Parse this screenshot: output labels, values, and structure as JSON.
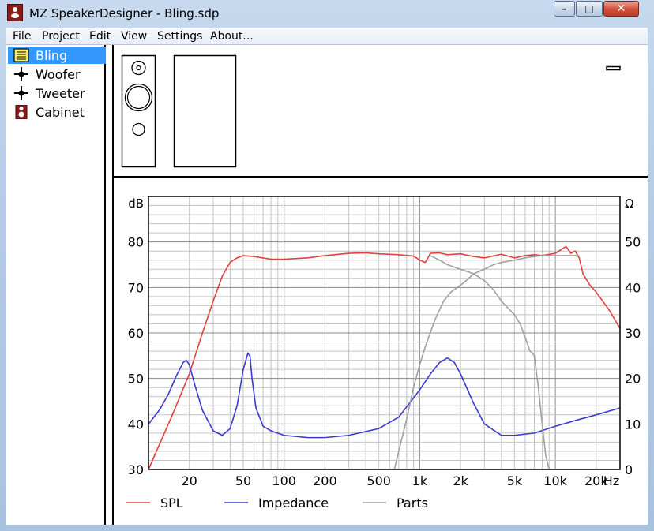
{
  "window": {
    "title": "MZ SpeakerDesigner - Bling.sdp",
    "minimize_glyph": "–",
    "maximize_glyph": "□",
    "close_glyph": "✕"
  },
  "menu": [
    "File",
    "Project",
    "Edit",
    "View",
    "Settings",
    "About..."
  ],
  "tree": [
    {
      "label": "Bling",
      "icon": "document-icon",
      "selected": true
    },
    {
      "label": "Woofer",
      "icon": "driver-node-icon",
      "selected": false
    },
    {
      "label": "Tweeter",
      "icon": "driver-node-icon",
      "selected": false
    },
    {
      "label": "Cabinet",
      "icon": "cabinet-icon",
      "selected": false
    }
  ],
  "chart_data": {
    "type": "line",
    "left_axis_unit": "dB",
    "right_axis_unit": "Ω",
    "x_unit": "Hz",
    "x_scale": "log",
    "xlim": [
      10,
      30000
    ],
    "ylim_left": [
      30,
      90
    ],
    "ylim_right": [
      0,
      60
    ],
    "grid": true,
    "legend_position": "bottom",
    "x_tick_labels": [
      "20",
      "50",
      "100",
      "200",
      "500",
      "1k",
      "2k",
      "5k",
      "10k",
      "20k"
    ],
    "x_tick_values": [
      20,
      50,
      100,
      200,
      500,
      1000,
      2000,
      5000,
      10000,
      20000
    ],
    "y_left_tick_labels": [
      "30",
      "40",
      "50",
      "60",
      "70",
      "80"
    ],
    "y_left_tick_values": [
      30,
      40,
      50,
      60,
      70,
      80
    ],
    "y_right_tick_labels": [
      "0",
      "10",
      "20",
      "30",
      "40",
      "50"
    ],
    "y_right_tick_values": [
      0,
      10,
      20,
      30,
      40,
      50
    ],
    "series": [
      {
        "name": "SPL",
        "color": "#e04040",
        "axis": "left",
        "x": [
          10,
          15,
          20,
          25,
          30,
          35,
          40,
          45,
          50,
          60,
          80,
          100,
          150,
          200,
          300,
          400,
          500,
          700,
          900,
          1000,
          1100,
          1200,
          1400,
          1600,
          2000,
          2500,
          3000,
          4000,
          5000,
          6000,
          7000,
          8000,
          10000,
          12000,
          13000,
          14000,
          15000,
          16000,
          18000,
          20000,
          25000,
          30000
        ],
        "y": [
          30,
          42,
          51,
          60,
          67,
          72.5,
          75.5,
          76.5,
          77,
          76.8,
          76.2,
          76.2,
          76.5,
          77,
          77.5,
          77.6,
          77.4,
          77.2,
          76.9,
          76,
          75.5,
          77.5,
          77.6,
          77.2,
          77.4,
          76.8,
          76.5,
          77.3,
          76.5,
          77,
          77.2,
          77,
          77.5,
          79,
          77.5,
          78,
          76.5,
          73,
          70.5,
          69,
          65,
          61
        ]
      },
      {
        "name": "Impedance",
        "color": "#3a3ad0",
        "axis": "right",
        "x": [
          10,
          12,
          14,
          16,
          18,
          19,
          20,
          22,
          25,
          30,
          35,
          40,
          45,
          50,
          54,
          56,
          58,
          62,
          70,
          80,
          100,
          150,
          200,
          300,
          500,
          700,
          1000,
          1200,
          1400,
          1600,
          1800,
          2000,
          2500,
          3000,
          4000,
          5000,
          7000,
          10000,
          15000,
          20000,
          30000
        ],
        "y": [
          10,
          13,
          16.5,
          20.5,
          23.5,
          24,
          23,
          18.5,
          13,
          8.5,
          7.5,
          9,
          14,
          22,
          25.5,
          25,
          20,
          13.5,
          9.5,
          8.5,
          7.5,
          7,
          7,
          7.5,
          9,
          11.5,
          17.5,
          21,
          23.5,
          24.5,
          23.5,
          21,
          14.5,
          10,
          7.5,
          7.5,
          8,
          9.5,
          11,
          12,
          13.5
        ]
      },
      {
        "name": "Parts",
        "color": "#a0a0a0",
        "axis": "left",
        "x": [
          650,
          700,
          800,
          900,
          1000,
          1100,
          1300,
          1500,
          1700,
          2000,
          2200,
          2500,
          3000,
          3500,
          4000,
          5000,
          6000,
          7000,
          8000,
          9000,
          10000,
          12000,
          15000,
          1200,
          1400,
          1600,
          2000,
          2500,
          3000,
          3500,
          4000,
          5000,
          5500,
          6000,
          6500,
          6800,
          7000,
          7500,
          8000,
          8500,
          9000
        ],
        "y": [
          30,
          34,
          41,
          48,
          53,
          57,
          63,
          67,
          69,
          70.5,
          71.5,
          73,
          74,
          75,
          75.5,
          76,
          76.5,
          76.8,
          77,
          77,
          77,
          77,
          77,
          77,
          76,
          75,
          74,
          73,
          71.5,
          69.5,
          67,
          64,
          62,
          59,
          56,
          55.5,
          55,
          48,
          40,
          33,
          30
        ]
      }
    ]
  }
}
